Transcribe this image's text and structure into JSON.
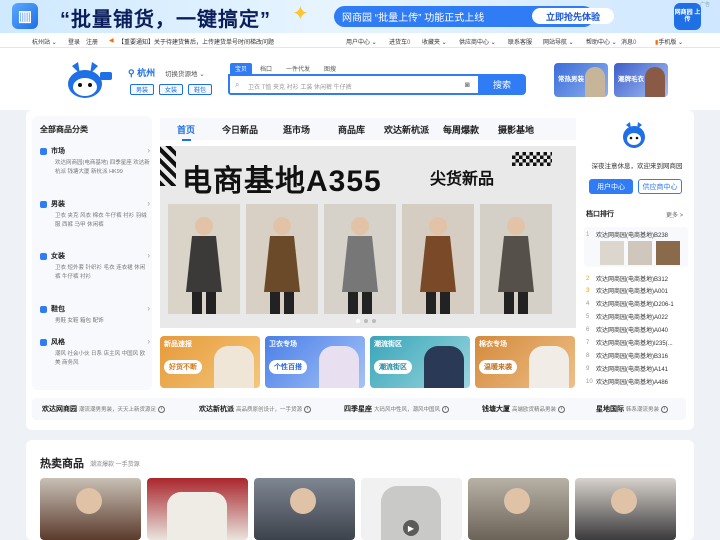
{
  "banner": {
    "slogan": "“批量铺货，一键搞定”",
    "upload_text": "网商园 “批量上传” 功能正式上线",
    "upload_button": "立即抢先体验",
    "cube_text": "网商园\n上传",
    "ad_mark": "广告"
  },
  "topnav": {
    "station": "杭州站 ⌄",
    "login": "登录",
    "register": "注册",
    "notice": "【重要通知】关于待建货售后，上传建货单号时间梯改问题",
    "user_center": "用户中心 ⌄",
    "cart": "进货车",
    "cart_count": "0",
    "favorites": "收藏夹 ⌄",
    "supplier_center": "供应商中心 ⌄",
    "contact": "联系客服",
    "site_nav": "网站导航 ⌄",
    "help": "帮助中心 ⌄",
    "messages": "消息",
    "message_count": "0",
    "mobile": "手机版 ⌄"
  },
  "header": {
    "city": "杭州",
    "switch_source": "切换货源地 ⌄",
    "city_tags": [
      "男装",
      "女装",
      "鞋包"
    ],
    "search_tabs": [
      "宝贝",
      "档口",
      "一件代发",
      "图搜"
    ],
    "search_hint": "卫衣 T恤 夹克 衬衫 工装 休闲裤 牛仔裤",
    "search_button": "搜索",
    "promo1": "常热男装",
    "promo2": "潮牌毛衣"
  },
  "sidebar": {
    "title": "全部商品分类",
    "categories": [
      {
        "name": "市场",
        "sub": "欢达网商园(电商基地)  四季星座  欢达新杭派  钱塘大厦  新杭派  HK99"
      },
      {
        "name": "男装",
        "sub": "卫衣  夹克  风衣  棉衣  牛仔裤  衬衫  羽绒服  西裤  马甲  休闲裤"
      },
      {
        "name": "女装",
        "sub": "卫衣  短外套  针织衫  毛衣  连衣裙  休闲裤  牛仔裤  衬衫"
      },
      {
        "name": "鞋包",
        "sub": "男鞋  女鞋  箱包  配饰"
      },
      {
        "name": "风格",
        "sub": "潮风  社会小伙  日系  店主风  中国风  欧美  商务风"
      }
    ]
  },
  "main_tabs": [
    "首页",
    "今日新品",
    "逛市场",
    "商品库",
    "欢达新杭派",
    "每周爆款",
    "摄影基地"
  ],
  "hero": {
    "title": "电商基地A355",
    "subtitle": "尖货新品"
  },
  "ads": [
    {
      "label": "新品速报",
      "pill": "好货不断"
    },
    {
      "label": "卫衣专场",
      "pill": "个性百搭"
    },
    {
      "label": "潮流街区",
      "pill": "潮流街区"
    },
    {
      "label": "棉衣专场",
      "pill": "温暖来袭"
    }
  ],
  "right_panel": {
    "welcome": "深夜注意休息，欢迎来到网商园",
    "user_center_btn": "用户中心",
    "supplier_center_btn": "供应商中心",
    "ranking_title": "档口排行",
    "more": "更多 >",
    "rankings": [
      {
        "n": "1",
        "name": "欢达网商园(电商基地)B238"
      },
      {
        "n": "2",
        "name": "欢达网商园(电商基地)B312"
      },
      {
        "n": "3",
        "name": "欢达网商园(电商基地)A001"
      },
      {
        "n": "4",
        "name": "欢达网商园(电商基地)D206-1"
      },
      {
        "n": "5",
        "name": "欢达网商园(电商基地)A022"
      },
      {
        "n": "6",
        "name": "欢达网商园(电商基地)A040"
      },
      {
        "n": "7",
        "name": "欢达网商园(电商基地)I235(..."
      },
      {
        "n": "8",
        "name": "欢达网商园(电商基地)B316"
      },
      {
        "n": "9",
        "name": "欢达网商园(电商基地)A141"
      },
      {
        "n": "10",
        "name": "欢达网商园(电商基地)A486"
      }
    ]
  },
  "markets": [
    {
      "name": "欢达网商园",
      "desc": "潮流潮男男装，天天上新货源足"
    },
    {
      "name": "欢达新杭派",
      "desc": "高品质原创设计，一手货源"
    },
    {
      "name": "四季星座",
      "desc": "大码风中性风，潮风中国风"
    },
    {
      "name": "钱塘大厦",
      "desc": "高端欧货精品男装"
    },
    {
      "name": "星地国际",
      "desc": "韩系潮流男装"
    }
  ],
  "hot": {
    "title": "热卖商品",
    "subtitle": "潮流爆款 一手货源"
  },
  "colors": {
    "brand": "#2f7cf5",
    "banner_text": "#0b1e5b",
    "notice_red": "#e33"
  }
}
